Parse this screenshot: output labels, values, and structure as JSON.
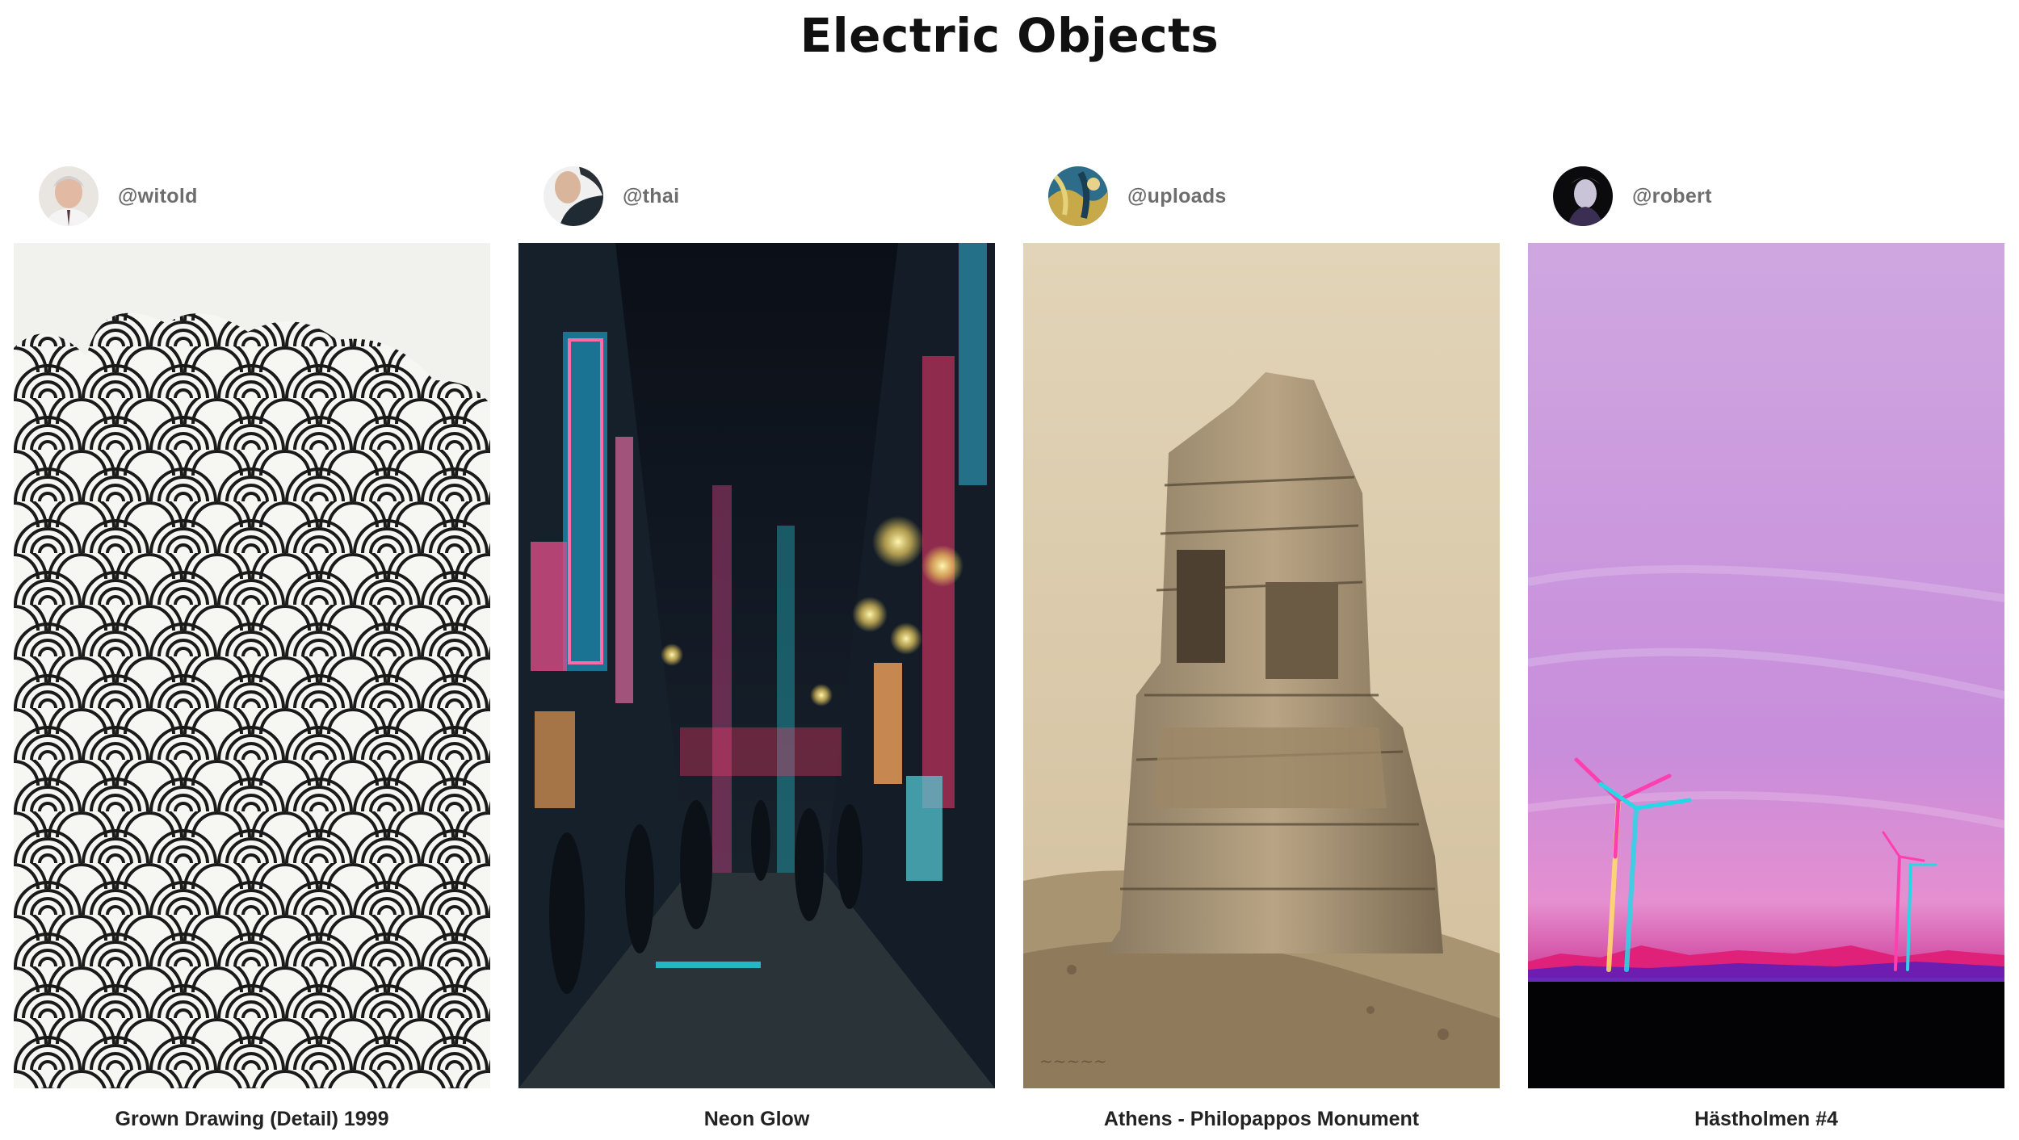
{
  "page": {
    "title": "Electric Objects"
  },
  "cards": [
    {
      "username": "@witold",
      "artwork_title": "Grown Drawing (Detail) 1999",
      "avatar_icon": "portrait-avatar-grey-hair",
      "artwork_subject": "black ink concentric line drawing"
    },
    {
      "username": "@thai",
      "artwork_title": "Neon Glow",
      "avatar_icon": "portrait-avatar-dark",
      "artwork_subject": "night street with neon signs"
    },
    {
      "username": "@uploads",
      "artwork_title": "Athens - Philopappos Monument",
      "avatar_icon": "painting-avatar-blue",
      "artwork_subject": "sepia photograph of monument ruin"
    },
    {
      "username": "@robert",
      "artwork_title": "Hästholmen #4",
      "avatar_icon": "portrait-avatar-black",
      "artwork_subject": "wind turbines under purple sky"
    }
  ],
  "colors": {
    "neon_pink": "#ff4fa0",
    "neon_cyan": "#27d7e6",
    "sepia": "#cbb797",
    "lilac_sky": "#c79adc"
  }
}
